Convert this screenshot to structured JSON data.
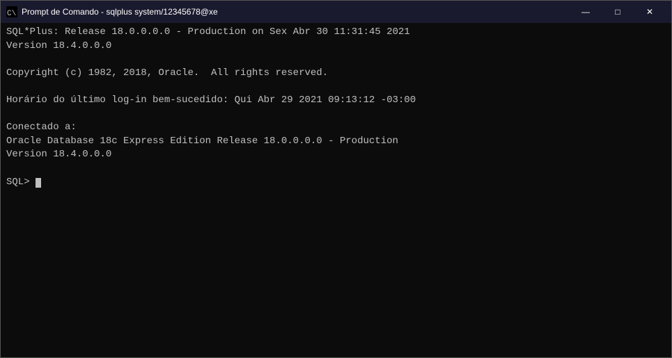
{
  "titleBar": {
    "icon": "cmd-icon",
    "text": "Prompt de Comando - sqlplus  system/12345678@xe",
    "minimize": "—",
    "maximize": "□",
    "close": "✕"
  },
  "terminal": {
    "lines": [
      "SQL*Plus: Release 18.0.0.0.0 - Production on Sex Abr 30 11:31:45 2021",
      "Version 18.4.0.0.0",
      "",
      "Copyright (c) 1982, 2018, Oracle.  All rights reserved.",
      "",
      "Horário do último log-in bem-sucedido: Qui Abr 29 2021 09:13:12 -03:00",
      "",
      "Conectado a:",
      "Oracle Database 18c Express Edition Release 18.0.0.0.0 - Production",
      "Version 18.4.0.0.0",
      "",
      "SQL> "
    ]
  }
}
